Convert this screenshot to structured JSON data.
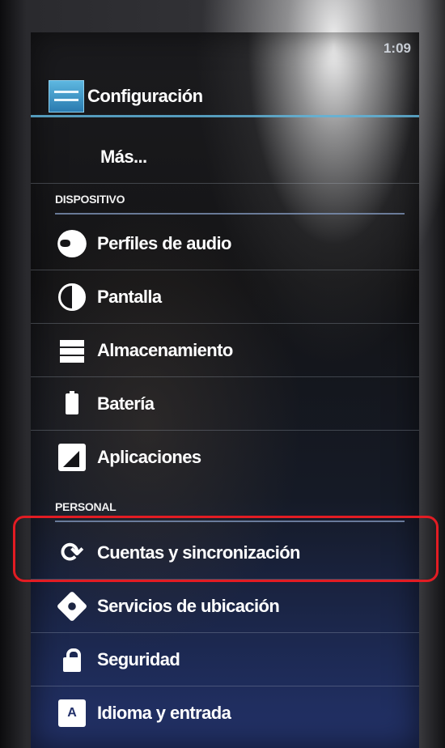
{
  "status": {
    "time": "1:09"
  },
  "header": {
    "title": "Configuración"
  },
  "sections": {
    "device": "DISPOSITIVO",
    "personal": "PERSONAL"
  },
  "items": {
    "more": "Más...",
    "audio_profiles": "Perfiles de audio",
    "display": "Pantalla",
    "storage": "Almacenamiento",
    "battery": "Batería",
    "apps": "Aplicaciones",
    "accounts_sync": "Cuentas y sincronización",
    "location": "Servicios de ubicación",
    "security": "Seguridad",
    "language": "Idioma y entrada"
  },
  "icons": {
    "settings": "settings-icon",
    "audio_profiles": "speaker-icon",
    "display": "brightness-icon",
    "storage": "storage-icon",
    "battery": "battery-icon",
    "apps": "apps-icon",
    "accounts_sync": "sync-icon",
    "location": "location-icon",
    "security": "lock-icon",
    "language": "keyboard-icon"
  },
  "language_icon_letter": "A",
  "colors": {
    "highlight": "#e21c23",
    "accent_rule": "#5fb3d8"
  }
}
